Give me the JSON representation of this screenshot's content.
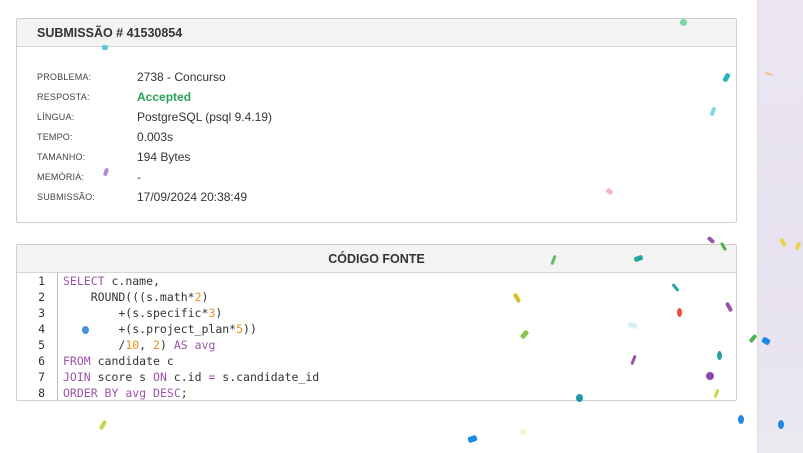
{
  "submission": {
    "title": "SUBMISSÃO # 41530854",
    "fields": [
      {
        "label": "PROBLEMA:",
        "value": "2738 - Concurso"
      },
      {
        "label": "RESPOSTA:",
        "value": "Accepted"
      },
      {
        "label": "LÍNGUA:",
        "value": "PostgreSQL (psql 9.4.19)"
      },
      {
        "label": "TEMPO:",
        "value": "0.003s"
      },
      {
        "label": "TAMANHO:",
        "value": "194 Bytes"
      },
      {
        "label": "MEMÓRIA:",
        "value": "-"
      },
      {
        "label": "SUBMISSÃO:",
        "value": "17/09/2024 20:38:49"
      }
    ],
    "accepted_color": "#2aa35a"
  },
  "source": {
    "title": "CÓDIGO FONTE",
    "line_numbers": [
      "1",
      "2",
      "3",
      "4",
      "5",
      "6",
      "7",
      "8"
    ],
    "lines": [
      [
        {
          "t": "SELECT",
          "c": "kw"
        },
        {
          "t": " c.name,",
          "c": "txt"
        }
      ],
      [
        {
          "t": "    ROUND(((s.math*",
          "c": "txt"
        },
        {
          "t": "2",
          "c": "num-lit"
        },
        {
          "t": ")",
          "c": "txt"
        }
      ],
      [
        {
          "t": "        +(s.specific*",
          "c": "txt"
        },
        {
          "t": "3",
          "c": "num-lit"
        },
        {
          "t": ")",
          "c": "txt"
        }
      ],
      [
        {
          "t": "        +(s.project_plan*",
          "c": "txt"
        },
        {
          "t": "5",
          "c": "num-lit"
        },
        {
          "t": "))",
          "c": "txt"
        }
      ],
      [
        {
          "t": "        /",
          "c": "txt"
        },
        {
          "t": "10",
          "c": "num-lit"
        },
        {
          "t": ", ",
          "c": "txt"
        },
        {
          "t": "2",
          "c": "num-lit"
        },
        {
          "t": ") ",
          "c": "txt"
        },
        {
          "t": "AS",
          "c": "kw"
        },
        {
          "t": " ",
          "c": "txt"
        },
        {
          "t": "avg",
          "c": "kw"
        }
      ],
      [
        {
          "t": "FROM",
          "c": "kw"
        },
        {
          "t": " candidate c",
          "c": "txt"
        }
      ],
      [
        {
          "t": "JOIN",
          "c": "kw"
        },
        {
          "t": " score s ",
          "c": "txt"
        },
        {
          "t": "ON",
          "c": "kw"
        },
        {
          "t": " c.id ",
          "c": "txt"
        },
        {
          "t": "=",
          "c": "kw"
        },
        {
          "t": " s.candidate_id",
          "c": "txt"
        }
      ],
      [
        {
          "t": "ORDER BY",
          "c": "kw"
        },
        {
          "t": " ",
          "c": "txt"
        },
        {
          "t": "avg",
          "c": "kw"
        },
        {
          "t": " ",
          "c": "txt"
        },
        {
          "t": "DESC",
          "c": "kw"
        },
        {
          "t": ";",
          "c": "txt"
        }
      ]
    ],
    "colors": {
      "keyword": "#9b53a8",
      "number": "#e8901e",
      "text": "#333333"
    }
  }
}
